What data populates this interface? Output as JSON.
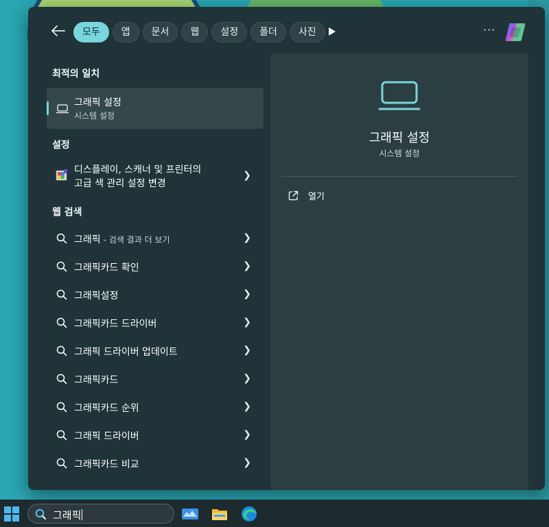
{
  "filters": {
    "tabs": [
      {
        "label": "모두",
        "active": true
      },
      {
        "label": "앱"
      },
      {
        "label": "문서"
      },
      {
        "label": "웹"
      },
      {
        "label": "설정"
      },
      {
        "label": "폴더"
      },
      {
        "label": "사진"
      }
    ],
    "more_label": "···"
  },
  "best_match": {
    "section_title": "최적의 일치",
    "title": "그래픽 설정",
    "subtitle": "시스템 설정",
    "icon": "laptop-icon"
  },
  "settings": {
    "section_title": "설정",
    "items": [
      {
        "line1": "디스플레이, 스캐너 및 프린터의",
        "line2": "고급 색 관리 설정 변경",
        "icon": "color-management-icon"
      }
    ]
  },
  "web_search": {
    "section_title": "웹 검색",
    "items": [
      {
        "query": "그래픽",
        "suffix": "- 검색 결과 더 보기"
      },
      {
        "query": "그래픽카드 확인"
      },
      {
        "query": "그래픽설정"
      },
      {
        "query": "그래픽카드 드라이버"
      },
      {
        "query": "그래픽 드라이버 업데이트"
      },
      {
        "query": "그래픽카드"
      },
      {
        "query": "그래픽카드 순위"
      },
      {
        "query": "그래픽 드라이버"
      },
      {
        "query": "그래픽카드 비교"
      }
    ]
  },
  "preview": {
    "title": "그래픽 설정",
    "subtitle": "시스템 설정",
    "actions": [
      {
        "label": "열기",
        "icon": "open-external-icon"
      }
    ]
  },
  "taskbar": {
    "search_value": "그래픽",
    "apps": [
      "weather-icon",
      "file-explorer-icon",
      "edge-icon"
    ]
  },
  "colors": {
    "accent": "#78d6dc",
    "panel": "#1f3338",
    "preview_pane": "#2b3e42"
  }
}
